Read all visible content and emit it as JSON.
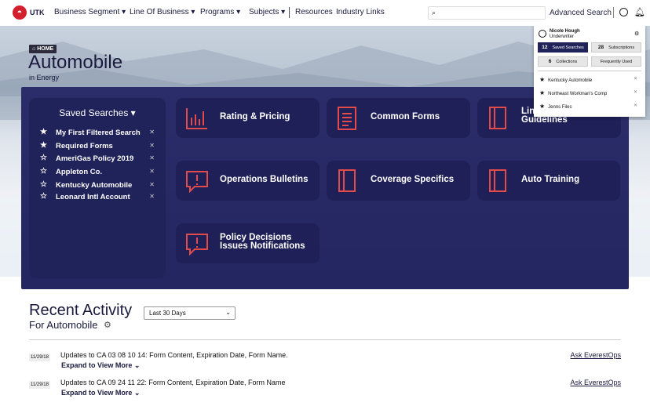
{
  "nav": {
    "brand": "UTK",
    "items": [
      "Business Segment",
      "Line Of Business",
      "Programs",
      "Subjects"
    ],
    "links": [
      "Resources",
      "Industry Links"
    ],
    "advanced_search": "Advanced Search",
    "search_placeholder": ""
  },
  "header": {
    "breadcrumb": "HOME",
    "title": "Automobile",
    "sub_prefix": "in",
    "sub_value": "Energy"
  },
  "saved_searches": {
    "title": "Saved Searches ▾",
    "items": [
      {
        "label": "My First Filtered Search",
        "starred": true
      },
      {
        "label": "Required Forms",
        "starred": true
      },
      {
        "label": "AmeriGas Policy 2019",
        "starred": false
      },
      {
        "label": "Appleton Co.",
        "starred": false
      },
      {
        "label": "Kentucky Automobile",
        "starred": false
      },
      {
        "label": "Leonard Intl Account",
        "starred": false
      }
    ]
  },
  "tiles": [
    {
      "label": "Rating & Pricing",
      "icon": "bar-chart-icon"
    },
    {
      "label": "Common Forms",
      "icon": "document-icon"
    },
    {
      "label": "Line of Guidelines",
      "icon": "book-icon"
    },
    {
      "label": "Operations Bulletins",
      "icon": "alert-icon"
    },
    {
      "label": "Coverage Specifics",
      "icon": "book-icon"
    },
    {
      "label": "Auto Training",
      "icon": "book-icon"
    },
    {
      "label": "Policy Decisions Issues Notifications",
      "icon": "alert-icon"
    }
  ],
  "user_menu": {
    "name": "Nicole Hough",
    "role": "Underwriter",
    "saved_count": "12",
    "saved_label": "Saved Searches",
    "subs_count": "28",
    "subs_label": "Subscriptions",
    "coll_count": "6",
    "coll_label": "Collections",
    "freq_label": "Frequently Used",
    "frequent": [
      "Kentucky Automobile",
      "Northeast Workman's Comp",
      "Jenns Files"
    ]
  },
  "recent": {
    "title": "Recent Activity",
    "subtitle": "For Automobile",
    "range": "Last 30 Days",
    "items": [
      {
        "date": "11/29/18",
        "text": "Updates to CA 03 08 10 14: Form Content, Expiration Date, Form Name.",
        "expand": "Expand to View More",
        "ask": "Ask EverestOps"
      },
      {
        "date": "11/29/18",
        "text": "Updates to CA 09 24 11 22: Form Content, Expiration Date, Form Name",
        "expand": "Expand to View More",
        "ask": "Ask EverestOps"
      }
    ]
  }
}
